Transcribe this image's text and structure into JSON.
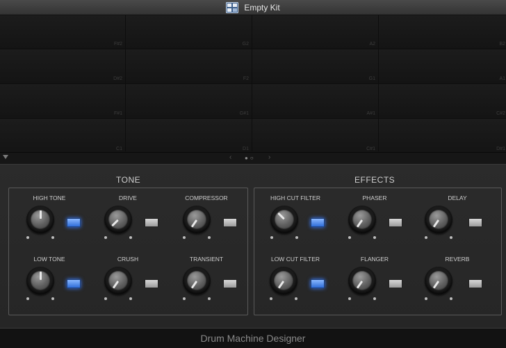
{
  "window": {
    "title": "Empty Kit"
  },
  "pads": [
    "F#2",
    "G2",
    "A2",
    "B2",
    "D#2",
    "F2",
    "G1",
    "A1",
    "F#1",
    "G#1",
    "A#1",
    "C#2",
    "C1",
    "D1",
    "C#1",
    "D#1"
  ],
  "tone": {
    "title": "TONE",
    "controls": [
      {
        "label": "HIGH TONE",
        "toggle_on": true
      },
      {
        "label": "DRIVE",
        "toggle_on": false
      },
      {
        "label": "COMPRESSOR",
        "toggle_on": false
      },
      {
        "label": "LOW TONE",
        "toggle_on": true
      },
      {
        "label": "CRUSH",
        "toggle_on": false
      },
      {
        "label": "TRANSIENT",
        "toggle_on": false
      }
    ]
  },
  "effects": {
    "title": "EFFECTS",
    "controls": [
      {
        "label": "HIGH CUT FILTER",
        "toggle_on": true
      },
      {
        "label": "PHASER",
        "toggle_on": false
      },
      {
        "label": "DELAY",
        "toggle_on": false
      },
      {
        "label": "LOW CUT FILTER",
        "toggle_on": true
      },
      {
        "label": "FLANGER",
        "toggle_on": false
      },
      {
        "label": "REVERB",
        "toggle_on": false
      }
    ]
  },
  "footer": {
    "label": "Drum Machine Designer"
  },
  "colors": {
    "toggle_on": "#2f6dd8",
    "toggle_off": "#c8c8c8",
    "background": "#262626"
  }
}
